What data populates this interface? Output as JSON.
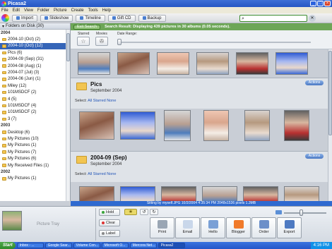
{
  "window": {
    "title": "Picasa2"
  },
  "menu": [
    "File",
    "Edit",
    "View",
    "Folder",
    "Picture",
    "Create",
    "Tools",
    "Help"
  ],
  "toolbar": {
    "import": "Import",
    "slideshow": "Slideshow",
    "timeline": "Timeline",
    "giftcd": "Gift CD",
    "backup": "Backup"
  },
  "sidebar": {
    "header": "Folders on Disk (30)",
    "rows": [
      {
        "type": "year",
        "label": "2004"
      },
      {
        "type": "item",
        "label": "2004-10 (Oct) (2)"
      },
      {
        "type": "item",
        "label": "2004-10 (Oct) (12)",
        "selected": true
      },
      {
        "type": "item",
        "label": "Pics (6)"
      },
      {
        "type": "item",
        "label": "2004-09 (Sep) (31)"
      },
      {
        "type": "item",
        "label": "2004-08 (Aug) (1)"
      },
      {
        "type": "item",
        "label": "2004-07 (Jul) (3)"
      },
      {
        "type": "item",
        "label": "2004-06 (Jun) (1)"
      },
      {
        "type": "item",
        "label": "Miley (12)"
      },
      {
        "type": "item",
        "label": "101MSDCF (2)"
      },
      {
        "type": "item",
        "label": "4 (5)"
      },
      {
        "type": "item",
        "label": "101MSDCF (4)"
      },
      {
        "type": "item",
        "label": "101MSDCF (2)"
      },
      {
        "type": "item",
        "label": "3 (7)"
      },
      {
        "type": "year",
        "label": "2003"
      },
      {
        "type": "item",
        "label": "Desktop (6)"
      },
      {
        "type": "item",
        "label": "My Pictures (10)"
      },
      {
        "type": "item",
        "label": "My Pictures (1)"
      },
      {
        "type": "item",
        "label": "My Pictures (7)"
      },
      {
        "type": "item",
        "label": "My Pictures (6)"
      },
      {
        "type": "item",
        "label": "My Received Files (1)"
      },
      {
        "type": "year",
        "label": "2002"
      },
      {
        "type": "item",
        "label": "My Pictures (1)"
      }
    ]
  },
  "search": {
    "exit_label": "Exit Search",
    "result_text": "Search Result: Displaying 439 pictures in 30 albums (0.05 seconds)."
  },
  "filters": {
    "starred": "Starred",
    "movies": "Movies",
    "date_range": "Date Range:"
  },
  "albums": [
    {
      "title": "Pics",
      "date": "September 2004",
      "actions": "Actions",
      "select_prefix": "Select:",
      "select_links": "All Starred None"
    },
    {
      "title": "2004-09 (Sep)",
      "date": "September 2004",
      "actions": "Actions",
      "select_prefix": "Select:",
      "select_links": "All Starred None"
    }
  ],
  "status": {
    "text": "Sitting by myself.JPG   10/2/2004 4:35:34 PM   2048x1536 pixels   1.3MB"
  },
  "tray": {
    "label": "Picture Tray",
    "hold": "Hold",
    "clear": "Clear",
    "label_btn": "Label",
    "actions": [
      "Print",
      "Email",
      "Hello",
      "Blogger",
      "Order",
      "Export"
    ]
  },
  "taskbar": {
    "start": "Start",
    "tasks": [
      "Inbox - ...",
      "Google Sear...",
      "Volume Con...",
      "Microsoft O...",
      "Mercora Net...",
      "Picasa2"
    ],
    "clock": "4:16 PM"
  },
  "colors": {
    "title_blue": "#2556c4",
    "search_green": "#6da657",
    "selection_blue": "#3565b8",
    "status_blue": "#2f6ad0"
  }
}
